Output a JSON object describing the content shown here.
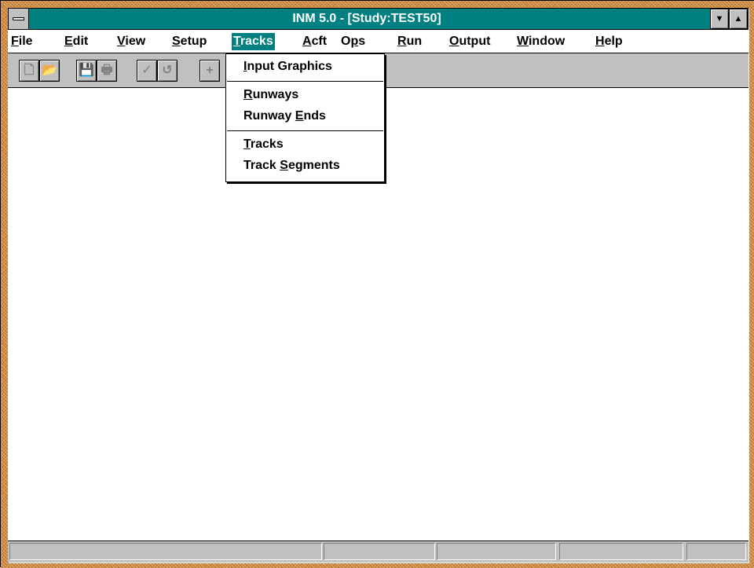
{
  "window": {
    "title": "INM 5.0 - [Study:TEST50]",
    "minimize_icon": "triangle-down-icon",
    "maximize_icon": "triangle-up-icon",
    "minimize_glyph": "▼",
    "maximize_glyph": "▲",
    "title_bar_color": "#008080",
    "frame_color": "#d08a3c"
  },
  "menubar": {
    "items": [
      {
        "label": "File",
        "accel": "F",
        "rest": "ile"
      },
      {
        "label": "Edit",
        "accel": "E",
        "rest": "dit"
      },
      {
        "label": "View",
        "accel": "V",
        "rest": "iew"
      },
      {
        "label": "Setup",
        "accel": "S",
        "rest": "etup"
      },
      {
        "label": "Tracks",
        "accel": "T",
        "rest": "racks"
      },
      {
        "label": "Acft",
        "accel": "A",
        "rest": "cft"
      },
      {
        "label": "Ops",
        "pre": "O",
        "accel": "p",
        "rest": "s"
      },
      {
        "label": "Run",
        "accel": "R",
        "rest": "un"
      },
      {
        "label": "Output",
        "accel": "O",
        "rest": "utput"
      },
      {
        "label": "Window",
        "accel": "W",
        "rest": "indow"
      },
      {
        "label": "Help",
        "accel": "H",
        "rest": "elp"
      }
    ],
    "active": "Tracks"
  },
  "toolbar": {
    "buttons": [
      {
        "icon": "new-file-icon",
        "glyph": "🗋"
      },
      {
        "icon": "open-folder-icon",
        "glyph": "📂"
      },
      {
        "icon": "save-icon",
        "glyph": "💾"
      },
      {
        "icon": "print-icon",
        "glyph": "🖶"
      },
      {
        "icon": "check-icon",
        "glyph": "✓"
      },
      {
        "icon": "undo-icon",
        "glyph": "↺"
      },
      {
        "icon": "plus-icon",
        "glyph": "+"
      }
    ]
  },
  "tracks_menu": {
    "groups": [
      [
        {
          "label": "Input Graphics",
          "accel": "I",
          "rest": "nput Graphics"
        }
      ],
      [
        {
          "label": "Runways",
          "accel": "R",
          "rest": "unways"
        },
        {
          "label": "Runway Ends",
          "pre": "Runway ",
          "accel": "E",
          "rest": "nds"
        }
      ],
      [
        {
          "label": "Tracks",
          "accel": "T",
          "rest": "racks"
        },
        {
          "label": "Track Segments",
          "pre": "Track ",
          "accel": "S",
          "rest": "egments"
        }
      ]
    ]
  },
  "statusbar": {
    "panes": [
      "",
      "",
      "",
      "",
      ""
    ]
  }
}
